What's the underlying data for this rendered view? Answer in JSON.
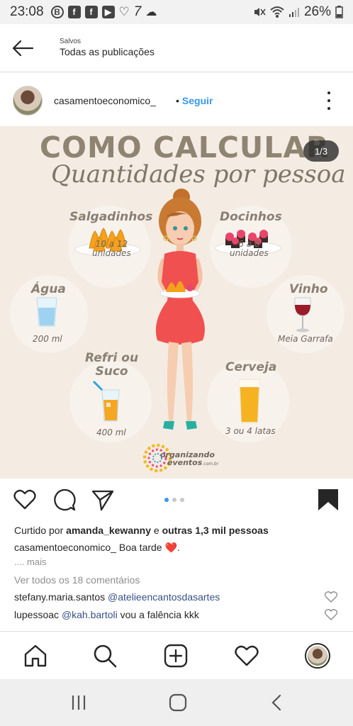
{
  "status_bar": {
    "time": "23:08",
    "battery": "26%",
    "icons": [
      "bitcoin-icon",
      "facebook-icon",
      "facebook-icon",
      "youtube-icon",
      "heart-outline-icon",
      "seven-icon",
      "cloud-icon"
    ]
  },
  "header": {
    "subtitle": "Salvos",
    "title": "Todas as publicações"
  },
  "post": {
    "username": "casamentoeconomico_",
    "follow_separator": "•",
    "follow_label": "Seguir",
    "counter": "1/3",
    "image": {
      "title_line1": "COMO CALCULAR",
      "title_line2": "Quantidades por pessoa",
      "items": [
        {
          "label": "Salgadinhos",
          "qty_line1": "10 a 12",
          "qty_line2": "unidades"
        },
        {
          "label": "Docinhos",
          "qty_line1": "6 a 8",
          "qty_line2": "unidades"
        },
        {
          "label": "Água",
          "qty_line1": "200 ml",
          "qty_line2": ""
        },
        {
          "label": "Vinho",
          "qty_line1": "Meia Garrafa",
          "qty_line2": ""
        },
        {
          "label_line1": "Refri ou",
          "label_line2": "Suco",
          "qty_line1": "400 ml",
          "qty_line2": ""
        },
        {
          "label": "Cerveja",
          "qty_line1": "3 ou 4 latas",
          "qty_line2": ""
        }
      ],
      "logo_line1": "organizando",
      "logo_line2": "eventos",
      "logo_suffix": ".com.br"
    },
    "carousel": {
      "total": 3,
      "active": 1
    },
    "likes": {
      "prefix": "Curtido por",
      "user": "amanda_kewanny",
      "connector": "e",
      "others": "outras 1,3 mil pessoas"
    },
    "caption": {
      "user": "casamentoeconomico_",
      "text": "Boa tarde",
      "emoji": "❤️",
      "suffix": "."
    },
    "more": ".... mais",
    "view_all": "Ver todos os 18 comentários",
    "comments": [
      {
        "user": "stefany.maria.santos",
        "mention": "@atelieencantosdasartes",
        "text": ""
      },
      {
        "user": "lupessoac",
        "mention": "@kah.bartoli",
        "text": "vou a falência kkk"
      }
    ]
  },
  "bottom_nav": [
    "home-icon",
    "search-icon",
    "new-post-icon",
    "activity-icon",
    "profile-avatar"
  ],
  "android_nav": [
    "recent-apps-icon",
    "home-button-icon",
    "back-button-icon"
  ],
  "colors": {
    "link_blue": "#3897f0",
    "mention_blue": "#385185",
    "muted_gray": "#8e8e8e",
    "image_bg": "#f4ebe3",
    "dress_red": "#f0504f"
  }
}
